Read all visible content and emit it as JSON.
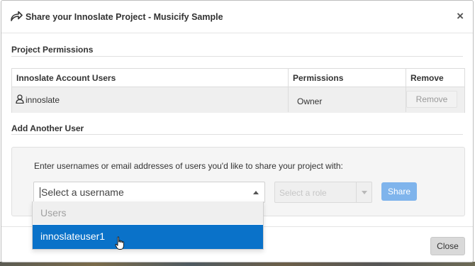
{
  "dialog": {
    "title": "Share your Innoslate Project - Musicify Sample",
    "close_glyph": "×"
  },
  "permissions": {
    "section_title": "Project Permissions",
    "columns": [
      "Innoslate Account Users",
      "Permissions",
      "Remove"
    ],
    "rows": [
      {
        "user": "innoslate",
        "permission": "Owner",
        "remove_label": "Remove"
      }
    ]
  },
  "add_user": {
    "section_title": "Add Another User",
    "instructions": "Enter usernames or email addresses of users you'd like to share your project with:",
    "username_placeholder": "Select a username",
    "role_placeholder": "Select a role",
    "share_label": "Share",
    "dropdown": {
      "group_label": "Users",
      "options": [
        "innoslateuser1"
      ],
      "highlighted_index": 0
    }
  },
  "footer": {
    "close_label": "Close"
  },
  "icons": {
    "header": "share-icon",
    "user": "user-icon",
    "cursor": "hand-pointer-icon"
  },
  "colors": {
    "share_button": "#7fb4ec",
    "highlight": "#0a72c9",
    "table_row": "#efefef"
  }
}
